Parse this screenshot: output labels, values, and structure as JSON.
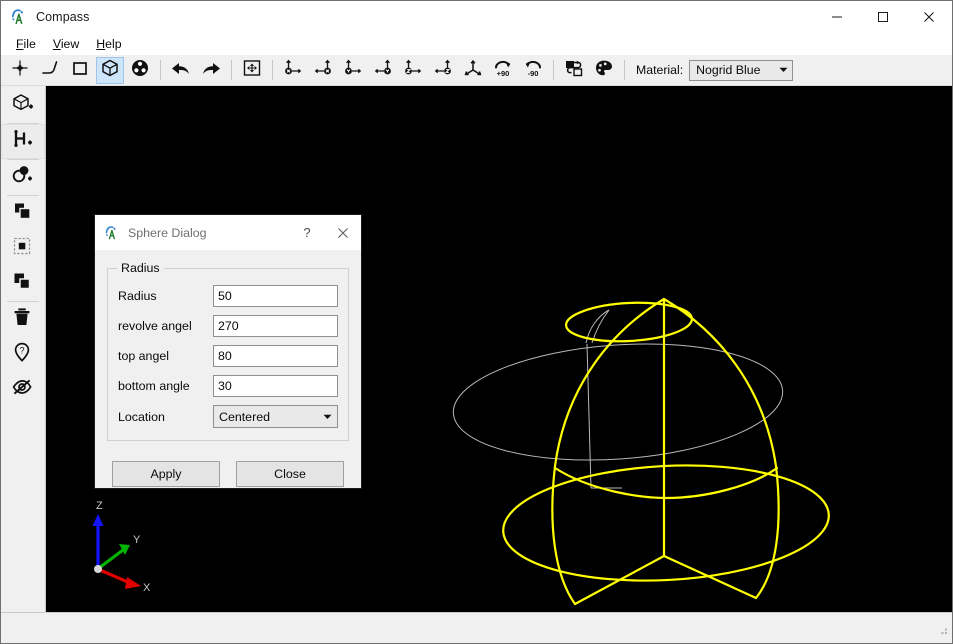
{
  "window": {
    "title": "Compass",
    "icon": "compass-app-icon",
    "controls": [
      {
        "name": "minimize-button",
        "glyph": "minimize"
      },
      {
        "name": "maximize-button",
        "glyph": "maximize"
      },
      {
        "name": "close-button",
        "glyph": "close"
      }
    ]
  },
  "menubar": {
    "items": [
      {
        "accel": "F",
        "rest": "ile"
      },
      {
        "accel": "V",
        "rest": "iew"
      },
      {
        "accel": "H",
        "rest": "elp"
      }
    ]
  },
  "toolbar": {
    "material_label": "Material:",
    "material_value": "Nogrid Blue",
    "buttons": [
      {
        "name": "point-tool-button",
        "icon": "crosshair-point-icon",
        "active": false
      },
      {
        "name": "line-tool-button",
        "icon": "polyline-icon",
        "active": false
      },
      {
        "name": "rectangle-tool-button",
        "icon": "square-icon",
        "active": false
      },
      {
        "name": "solid-tool-button",
        "icon": "cube-icon",
        "active": true
      },
      {
        "name": "sphere-tool-button",
        "icon": "sphere-dots-icon",
        "active": false
      },
      {
        "name": "undo-button",
        "icon": "undo-arrow-icon",
        "active": false
      },
      {
        "name": "redo-button",
        "icon": "redo-arrow-icon",
        "active": false
      },
      {
        "name": "fit-view-button",
        "icon": "fit-all-icon",
        "active": false
      },
      {
        "name": "view-x-positive-button",
        "icon": "axis-x-right-icon",
        "active": false
      },
      {
        "name": "view-x-negative-button",
        "icon": "axis-x-left-icon",
        "active": false
      },
      {
        "name": "view-y-positive-button",
        "icon": "axis-y-right-icon",
        "active": false
      },
      {
        "name": "view-y-negative-button",
        "icon": "axis-y-left-icon",
        "active": false
      },
      {
        "name": "view-z-positive-button",
        "icon": "axis-z-right-icon",
        "active": false
      },
      {
        "name": "view-z-negative-button",
        "icon": "axis-z-left-icon",
        "active": false
      },
      {
        "name": "isometric-view-button",
        "icon": "axis-tripod-icon",
        "active": false
      },
      {
        "name": "rotate-plus-90-button",
        "icon": "rotate-cw-90-icon",
        "label": "+90",
        "active": false
      },
      {
        "name": "rotate-minus-90-button",
        "icon": "rotate-ccw-90-icon",
        "label": "-90",
        "active": false
      },
      {
        "name": "copy-transform-button",
        "icon": "copy-shape-icon",
        "active": false
      },
      {
        "name": "material-palette-button",
        "icon": "palette-icon",
        "active": false
      }
    ]
  },
  "rail": {
    "items": [
      {
        "name": "sidebar-item-add-solid",
        "icon": "cube-plus-icon",
        "highlighted": false
      },
      {
        "name": "sidebar-item-add-axis",
        "icon": "axis-branch-plus-icon",
        "highlighted": true
      },
      {
        "name": "sidebar-item-add-boolean",
        "icon": "two-circles-plus-icon",
        "highlighted": false
      },
      {
        "name": "sidebar-item-copy",
        "icon": "copy-filled-icon",
        "highlighted": false
      },
      {
        "name": "sidebar-item-paste",
        "icon": "paste-dashed-icon",
        "highlighted": false
      },
      {
        "name": "sidebar-item-duplicate",
        "icon": "duplicate-icon",
        "highlighted": false
      },
      {
        "name": "sidebar-item-delete",
        "icon": "trash-icon",
        "highlighted": false
      },
      {
        "name": "sidebar-item-locate",
        "icon": "map-pin-question-icon",
        "highlighted": false
      },
      {
        "name": "sidebar-item-hide",
        "icon": "eye-slash-icon",
        "highlighted": false
      }
    ]
  },
  "viewport": {
    "background": "#000000",
    "wire_color": "#ffff00",
    "guide_color": "#b9b9b9",
    "axes": [
      {
        "label": "Z",
        "color": "#1414ff",
        "name": "axis-z-indicator"
      },
      {
        "label": "Y",
        "color": "#00b400",
        "name": "axis-y-indicator"
      },
      {
        "label": "X",
        "color": "#e00000",
        "name": "axis-x-indicator"
      }
    ]
  },
  "dialog": {
    "title": "Sphere Dialog",
    "icon": "compass-app-icon",
    "help_label": "?",
    "close_label": "✕",
    "group_title": "Radius",
    "fields": [
      {
        "name": "radius-field",
        "label": "Radius",
        "value": "50",
        "type": "text"
      },
      {
        "name": "revolve-angle-field",
        "label": "revolve angel",
        "value": "270",
        "type": "text"
      },
      {
        "name": "top-angle-field",
        "label": "top angel",
        "value": "80",
        "type": "text"
      },
      {
        "name": "bottom-angle-field",
        "label": "bottom angle",
        "value": "30",
        "type": "text"
      },
      {
        "name": "location-select",
        "label": "Location",
        "value": "Centered",
        "type": "select"
      }
    ],
    "apply_label": "Apply",
    "close_button_label": "Close"
  }
}
